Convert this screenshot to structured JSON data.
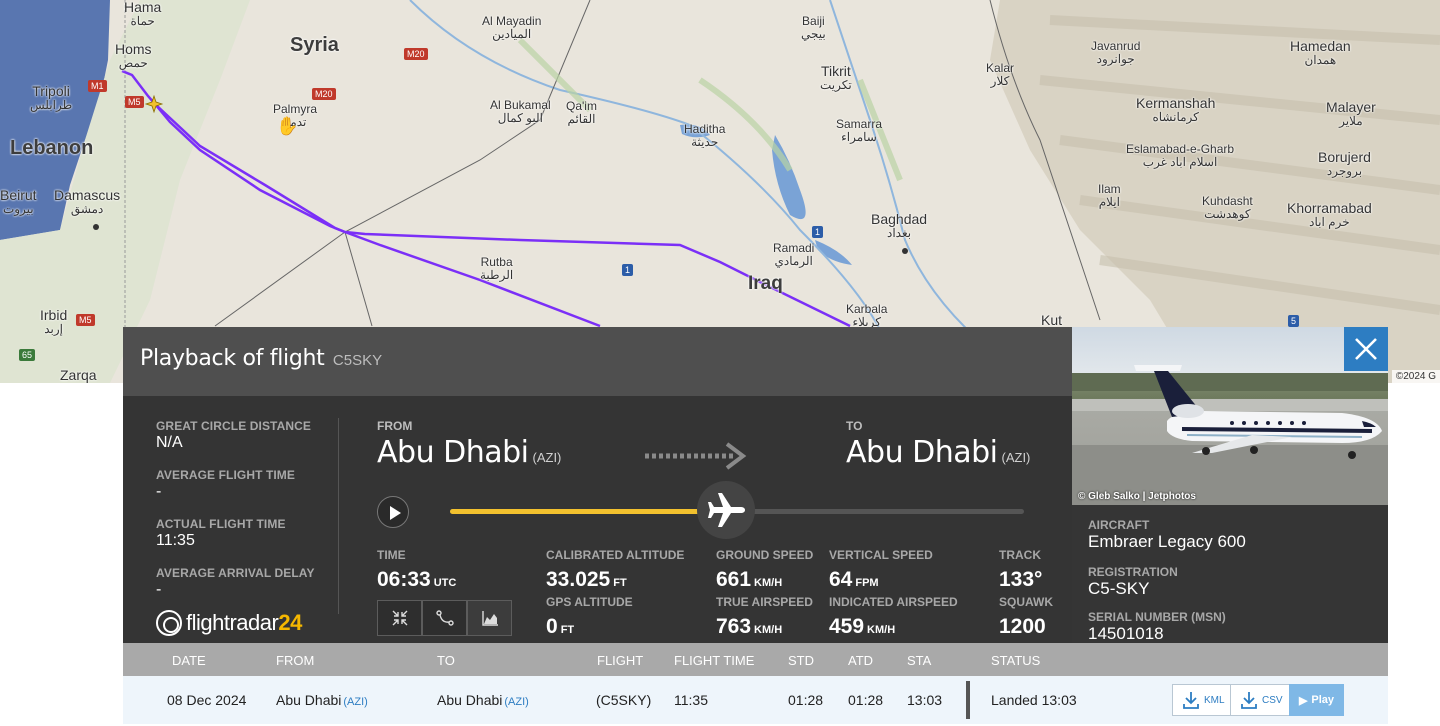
{
  "map": {
    "places": [
      {
        "name": "Hama",
        "ar": "حماة"
      },
      {
        "name": "Homs",
        "ar": "حمص"
      },
      {
        "name": "Tripoli",
        "ar": "طرابلس"
      },
      {
        "name": "Syria",
        "ar": ""
      },
      {
        "name": "Lebanon",
        "ar": ""
      },
      {
        "name": "Beirut",
        "ar": "بيروت"
      },
      {
        "name": "Damascus",
        "ar": "دمشق"
      },
      {
        "name": "Palmyra",
        "ar": "تدمر"
      },
      {
        "name": "Irbid",
        "ar": "إربد"
      },
      {
        "name": "Zarqa",
        "ar": ""
      },
      {
        "name": "Al Mayadin",
        "ar": "الميادين"
      },
      {
        "name": "Al Bukamal",
        "ar": "البو كمال"
      },
      {
        "name": "Qa'im",
        "ar": "القائم"
      },
      {
        "name": "Haditha",
        "ar": "حديثة"
      },
      {
        "name": "Baiji",
        "ar": "بيجي"
      },
      {
        "name": "Tikrit",
        "ar": "تكريت"
      },
      {
        "name": "Samarra",
        "ar": "سامراء"
      },
      {
        "name": "Kalar",
        "ar": "كلار"
      },
      {
        "name": "Baghdad",
        "ar": "بغداد"
      },
      {
        "name": "Ramadi",
        "ar": "الرمادي"
      },
      {
        "name": "Rutba",
        "ar": "الرطبة"
      },
      {
        "name": "Iraq",
        "ar": ""
      },
      {
        "name": "Karbala",
        "ar": "كربلاء"
      },
      {
        "name": "Kut",
        "ar": ""
      },
      {
        "name": "Javanrud",
        "ar": "جوانرود"
      },
      {
        "name": "Hamedan",
        "ar": "همدان"
      },
      {
        "name": "Kermanshah",
        "ar": "كرمانشاه"
      },
      {
        "name": "Malayer",
        "ar": "ملاير"
      },
      {
        "name": "Eslamabad-e-Gharb",
        "ar": "اسلام اباد غرب"
      },
      {
        "name": "Borujerd",
        "ar": "بروجرد"
      },
      {
        "name": "Ilam",
        "ar": "ايلام"
      },
      {
        "name": "Kuhdasht",
        "ar": "كوهدشت"
      },
      {
        "name": "Khorramabad",
        "ar": "خرم اباد"
      }
    ],
    "roads": [
      "M1",
      "M5",
      "M20",
      "M20",
      "M5",
      "65",
      "1",
      "1",
      "5"
    ],
    "copyright": "©2024 G"
  },
  "panel": {
    "title": "Playback of flight",
    "flight": "C5SKY",
    "stats": [
      {
        "label": "GREAT CIRCLE DISTANCE",
        "value": "N/A"
      },
      {
        "label": "AVERAGE FLIGHT TIME",
        "value": "-"
      },
      {
        "label": "ACTUAL FLIGHT TIME",
        "value": "11:35"
      },
      {
        "label": "AVERAGE ARRIVAL DELAY",
        "value": "-"
      }
    ],
    "from_label": "FROM",
    "from_city": "Abu Dhabi",
    "from_code": "(AZI)",
    "to_label": "TO",
    "to_city": "Abu Dhabi",
    "to_code": "(AZI)",
    "progress": 0.48,
    "metrics": {
      "time": {
        "label": "TIME",
        "value": "06:33",
        "unit": "UTC"
      },
      "cal_alt": {
        "label": "CALIBRATED ALTITUDE",
        "value": "33.025",
        "unit": "FT"
      },
      "gps_alt": {
        "label": "GPS ALTITUDE",
        "value": "0",
        "unit": "FT"
      },
      "ground_speed": {
        "label": "GROUND SPEED",
        "value": "661",
        "unit": "KM/H"
      },
      "true_airspeed": {
        "label": "TRUE AIRSPEED",
        "value": "763",
        "unit": "KM/H"
      },
      "vertical_speed": {
        "label": "VERTICAL SPEED",
        "value": "64",
        "unit": "FPM"
      },
      "indicated_airspeed": {
        "label": "INDICATED AIRSPEED",
        "value": "459",
        "unit": "KM/H"
      },
      "track": {
        "label": "TRACK",
        "value": "133°"
      },
      "squawk": {
        "label": "SQUAWK",
        "value": "1200"
      }
    },
    "logo_main": "flightradar",
    "logo_num": "24"
  },
  "aircraft": {
    "photo_credit": "© Gleb Salko | Jetphotos",
    "type_label": "AIRCRAFT",
    "type_value": "Embraer Legacy 600",
    "reg_label": "REGISTRATION",
    "reg_value": "C5-SKY",
    "msn_label": "SERIAL NUMBER (MSN)",
    "msn_value": "14501018"
  },
  "table": {
    "headers": [
      "DATE",
      "FROM",
      "TO",
      "FLIGHT",
      "FLIGHT TIME",
      "STD",
      "ATD",
      "STA",
      "STATUS"
    ],
    "row": {
      "date": "08 Dec 2024",
      "from": "Abu Dhabi",
      "from_code": "(AZI)",
      "to": "Abu Dhabi",
      "to_code": "(AZI)",
      "flight": "(C5SKY)",
      "flight_time": "11:35",
      "std": "01:28",
      "atd": "01:28",
      "sta": "13:03",
      "status": "Landed 13:03",
      "kml": "KML",
      "csv": "CSV",
      "play": "Play"
    }
  },
  "colors": {
    "track_purple": "#7b2ff7",
    "progress_yellow": "#f2c12e",
    "accent_blue": "#2d7dc2"
  }
}
